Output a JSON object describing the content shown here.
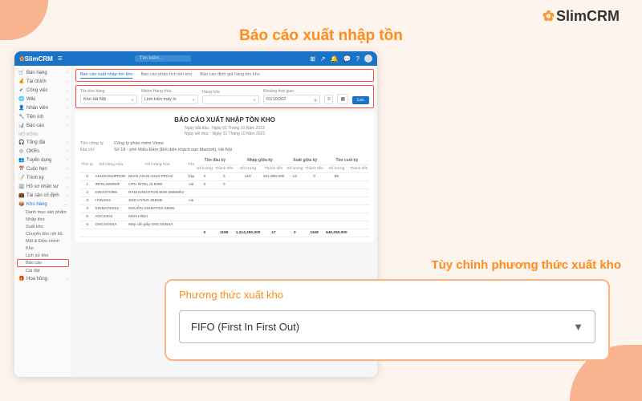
{
  "logo": "SlimCRM",
  "headline1": "Báo cáo xuất nhập tồn",
  "headline2": "Tùy chỉnh phương thức xuất kho",
  "topbar": {
    "brand": "SlimCRM",
    "search_ph": "Tìm kiếm..."
  },
  "sidebar": {
    "main": [
      {
        "icon": "🛒",
        "label": "Bán hàng"
      },
      {
        "icon": "💰",
        "label": "Tài chính"
      },
      {
        "icon": "✔",
        "label": "Công việc"
      },
      {
        "icon": "🌐",
        "label": "Wiki"
      },
      {
        "icon": "👤",
        "label": "Nhân viên"
      },
      {
        "icon": "🔧",
        "label": "Tiện ích"
      },
      {
        "icon": "📊",
        "label": "Báo cáo"
      }
    ],
    "section": "MỞ RỘNG",
    "ext": [
      {
        "icon": "🎧",
        "label": "Tổng đài"
      },
      {
        "icon": "◎",
        "label": "OKRs"
      },
      {
        "icon": "👥",
        "label": "Tuyển dụng"
      },
      {
        "icon": "📅",
        "label": "Cuộc hẹn"
      },
      {
        "icon": "📝",
        "label": "Trình ký"
      },
      {
        "icon": "🏢",
        "label": "Hồ sơ nhân sự"
      },
      {
        "icon": "💼",
        "label": "Tài sản cố định"
      },
      {
        "icon": "📦",
        "label": "Kho hàng",
        "active": true
      }
    ],
    "sub": [
      "Danh mục sản phẩm",
      "Nhập kho",
      "Xuất kho",
      "Chuyển kho nội bộ",
      "Mất & Điều chỉnh",
      "Kho",
      "Lịch sử kho",
      "Báo cáo",
      "Cài đặt"
    ],
    "last": {
      "icon": "🎁",
      "label": "Hoa hồng"
    }
  },
  "tabs": [
    "Báo cáo xuất nhập tồn kho",
    "Báo cáo phân tích tồn kho",
    "Báo cáo định giá hàng tồn kho"
  ],
  "filters": {
    "f1": {
      "label": "Tên kho hàng",
      "value": "Kho Hà Nội"
    },
    "f2": {
      "label": "Nhóm Hàng Hóa",
      "value": "Linh kiện máy in"
    },
    "f3": {
      "label": "Hàng hóa",
      "value": ""
    },
    "f4": {
      "label": "Khoảng thời gian",
      "value": "01/10/202"
    },
    "btn": "Lọc"
  },
  "report": {
    "title": "BÁO CÁO XUẤT NHẬP TỒN KHO",
    "d1": "Ngày bắt đầu : Ngày 01 Tháng 10 Năm 2023",
    "d2": "Ngày kết thúc : Ngày 31 Tháng 10 Năm 2023",
    "company_l": "Tên công ty",
    "company": "Công ty phần mềm Vinno",
    "addr_l": "Địa chỉ",
    "addr": "Số 18 - phố Miếu Đầm (Đối diện khách sạn Marriott), Hà Nội",
    "head": {
      "stt": "Thứ tự",
      "code": "Mã Hàng Hóa",
      "name": "Tên Hàng Hóa",
      "desc": "Tên",
      "g1": "Tồn đầu kỳ",
      "g2": "Nhập giữa kỳ",
      "g3": "Xuất giữa kỳ",
      "g4": "Tồn cuối kỳ",
      "qty": "Số lượng",
      "amt": "Thành tiền"
    },
    "rows": [
      {
        "stt": "0",
        "code": "ASUSH310PROE",
        "name": "MAIN ASUS H310 PRO-E",
        "desc": "hộp",
        "q1": "0",
        "a1": "0",
        "q2": "110",
        "a2": "191,000,000",
        "q3": "12",
        "a3": "0",
        "q4": "99",
        "a4": ""
      },
      {
        "stt": "1",
        "code": "INTELI59350F",
        "name": "CPU INTEL I5 9350",
        "desc": "cái",
        "q1": "0",
        "a1": "0",
        "q2": "",
        "a2": "",
        "q3": "",
        "a3": "",
        "q4": "",
        "a4": ""
      },
      {
        "stt": "2",
        "code": "KINGSTON8",
        "name": "RAM KINGSTON 8GB 2666Mhz",
        "desc": "",
        "q1": "",
        "a1": "",
        "q2": "",
        "a2": "",
        "q3": "",
        "a3": "",
        "q4": "",
        "a4": ""
      },
      {
        "stt": "3",
        "code": "HYNIX51",
        "name": "SSD HYNIX 256GB",
        "desc": "cái",
        "q1": "",
        "a1": "",
        "q2": "",
        "a2": "",
        "q3": "",
        "a3": "",
        "q4": "",
        "a4": ""
      },
      {
        "stt": "4",
        "code": "XIGMATEK01",
        "name": "NGUỒN XIGMATEK 650W",
        "desc": "",
        "q1": "",
        "a1": "",
        "q2": "",
        "a2": "",
        "q3": "",
        "a3": "",
        "q4": "",
        "a4": ""
      },
      {
        "stt": "5",
        "code": "AOC24G2",
        "name": "MÀN HÌNH",
        "desc": "",
        "q1": "",
        "a1": "",
        "q2": "",
        "a2": "",
        "q3": "",
        "a3": "",
        "q4": "",
        "a4": ""
      },
      {
        "stt": "6",
        "code": "GNC10254A",
        "name": "Máy cắt giấy GNC10254A",
        "desc": "",
        "q1": "",
        "a1": "",
        "q2": "",
        "a2": "",
        "q3": "",
        "a3": "",
        "q4": "",
        "a4": ""
      }
    ],
    "total": {
      "q1": "0",
      "a1": "1185",
      "a2": "1,214,250,000",
      "q2": "17",
      "q3": "0",
      "a3": "1168",
      "a4": "546,250,000"
    }
  },
  "card": {
    "title": "Phương thức xuất kho",
    "value": "FIFO (First In First Out)"
  }
}
